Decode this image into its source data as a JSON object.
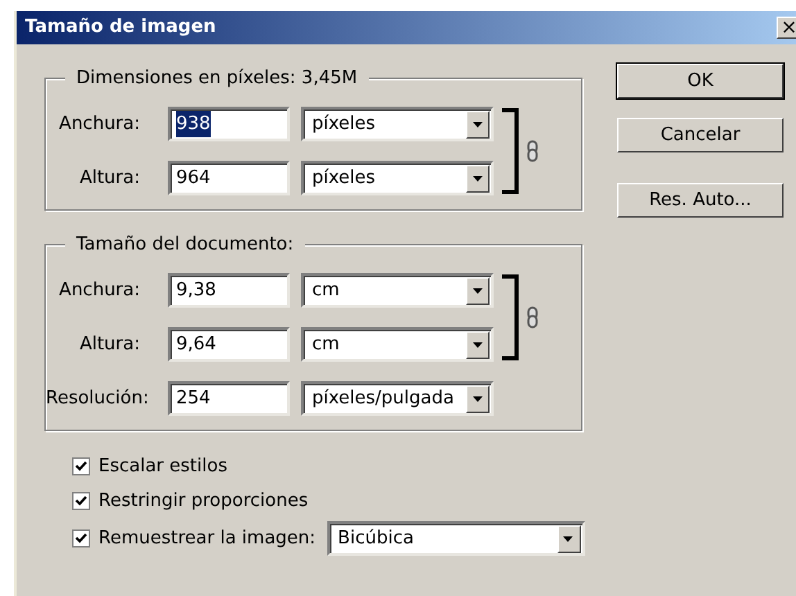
{
  "window": {
    "title": "Tamaño de imagen",
    "close": "×"
  },
  "groups": [
    {
      "title": "Dimensiones en píxeles: 3,45M",
      "linked": true,
      "rows": [
        {
          "label": "Anchura:",
          "value": "938",
          "highlighted": true,
          "unit": "píxeles"
        },
        {
          "label": "Altura:",
          "value": "964",
          "highlighted": false,
          "unit": "píxeles"
        }
      ]
    },
    {
      "title": "Tamaño del documento:",
      "linked": true,
      "rows": [
        {
          "label": "Anchura:",
          "value": "9,38",
          "highlighted": false,
          "unit": "cm"
        },
        {
          "label": "Altura:",
          "value": "9,64",
          "highlighted": false,
          "unit": "cm"
        },
        {
          "label": "Resolución:",
          "value": "254",
          "highlighted": false,
          "unit": "píxeles/pulgada"
        }
      ]
    }
  ],
  "buttons": [
    {
      "label": "OK",
      "default": true
    },
    {
      "label": "Cancelar",
      "default": false
    },
    {
      "label": "Res. Auto...",
      "default": false
    }
  ],
  "options": [
    {
      "label": "Escalar estilos",
      "checked": true
    },
    {
      "label": "Restringir proporciones",
      "checked": true
    },
    {
      "label": "Remuestrear la imagen:",
      "checked": true,
      "select": "Bicúbica"
    }
  ]
}
